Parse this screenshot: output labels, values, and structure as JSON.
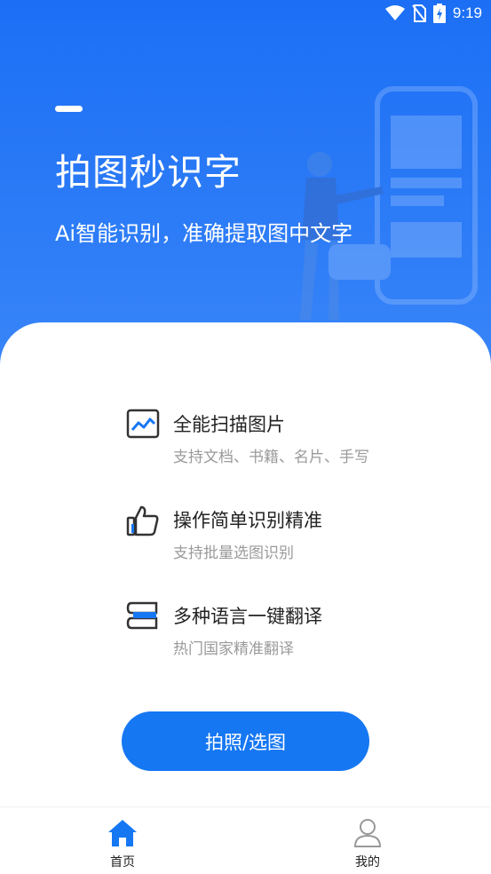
{
  "status_bar": {
    "time": "9:19",
    "icons": [
      "wifi-icon",
      "no-sim-icon",
      "battery-charging-icon"
    ]
  },
  "hero": {
    "title": "拍图秒识字",
    "subtitle": "Ai智能识别，准确提取图中文字",
    "background_color": "#1c6ff5"
  },
  "features": [
    {
      "icon": "image-icon",
      "title": "全能扫描图片",
      "desc": "支持文档、书籍、名片、手写"
    },
    {
      "icon": "thumbs-up-icon",
      "title": "操作简单识别精准",
      "desc": "支持批量选图识别"
    },
    {
      "icon": "translate-icon",
      "title": "多种语言一键翻译",
      "desc": "热门国家精准翻译"
    }
  ],
  "action": {
    "label": "拍照/选图",
    "color": "#1677f3"
  },
  "tabs": [
    {
      "label": "首页",
      "icon": "home-icon",
      "active": true,
      "color": "#1677f3"
    },
    {
      "label": "我的",
      "icon": "profile-icon",
      "active": false,
      "color": "#999999"
    }
  ]
}
